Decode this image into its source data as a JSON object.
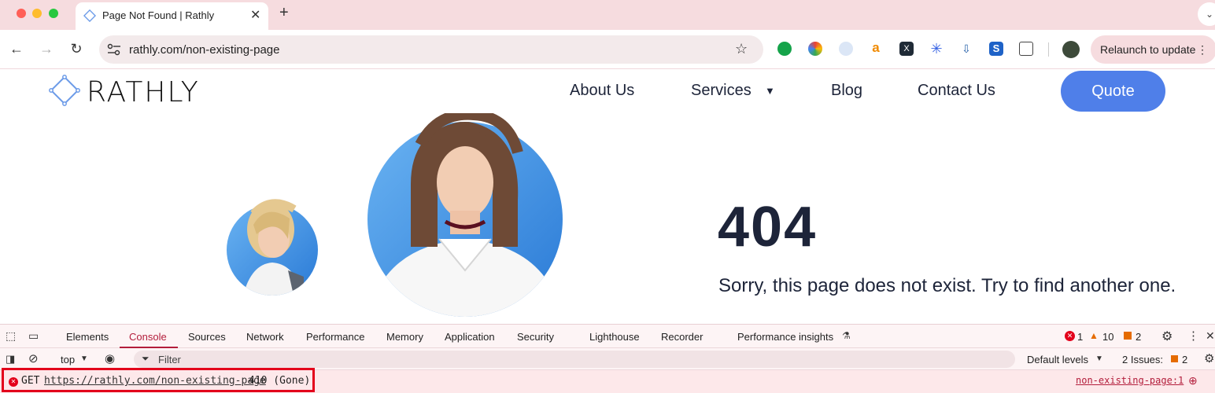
{
  "browser": {
    "tab_title": "Page Not Found | Rathly",
    "new_tab": "+",
    "url": "rathly.com/non-existing-page",
    "relaunch": "Relaunch to update",
    "relaunch_menu": "⋮"
  },
  "site": {
    "logo": "RATHLY",
    "nav": {
      "about": "About Us",
      "services": "Services",
      "blog": "Blog",
      "contact": "Contact Us",
      "quote": "Quote"
    },
    "error_code": "404",
    "message": "Sorry, this page does not exist. Try to find another one."
  },
  "devtools": {
    "tabs": {
      "elements": "Elements",
      "console": "Console",
      "sources": "Sources",
      "network": "Network",
      "performance": "Performance",
      "memory": "Memory",
      "application": "Application",
      "security": "Security",
      "lighthouse": "Lighthouse",
      "recorder": "Recorder",
      "perf_insights": "Performance insights"
    },
    "counts": {
      "errors": "1",
      "warnings": "10",
      "issues": "2"
    },
    "context": "top",
    "filter_placeholder": "Filter",
    "levels": "Default levels",
    "issues_label": "2 Issues:",
    "issues_count": "2",
    "log": {
      "method": "GET",
      "url": "https://rathly.com/non-existing-page",
      "status": "410 (Gone)",
      "source": "non-existing-page:1"
    }
  },
  "colors": {
    "accent": "#4f7fe9",
    "error": "#e3001b",
    "devtools_active": "#b31d3b"
  }
}
